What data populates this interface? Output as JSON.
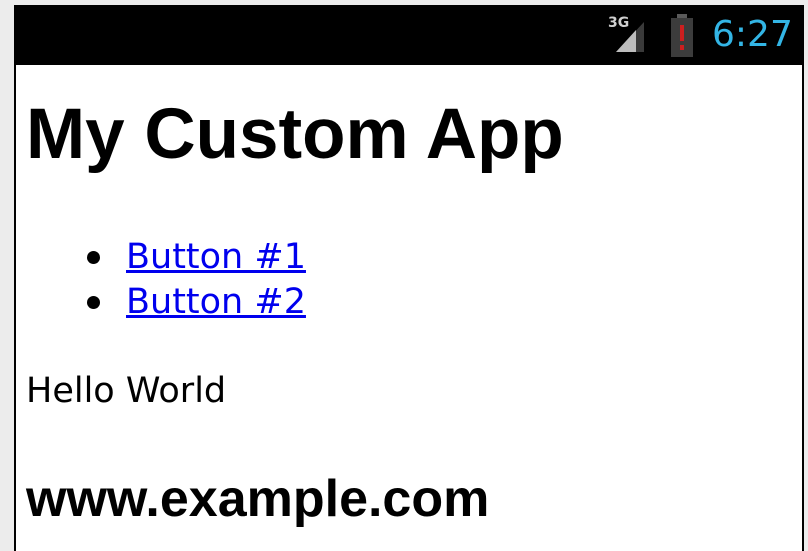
{
  "status_bar": {
    "network_type": "3G",
    "time": "6:27",
    "icons": [
      "signal-icon",
      "battery-alert-icon"
    ],
    "colors": {
      "background": "#000000",
      "clock": "#33b5e5",
      "battery_alert": "#cc1f1f"
    }
  },
  "app": {
    "title": "My Custom App",
    "nav_items": [
      {
        "label": "Button #1"
      },
      {
        "label": "Button #2"
      }
    ],
    "greeting": "Hello World",
    "website": "www.example.com",
    "colors": {
      "background": "#ffffff",
      "link": "#0000ee",
      "text": "#000000"
    }
  }
}
